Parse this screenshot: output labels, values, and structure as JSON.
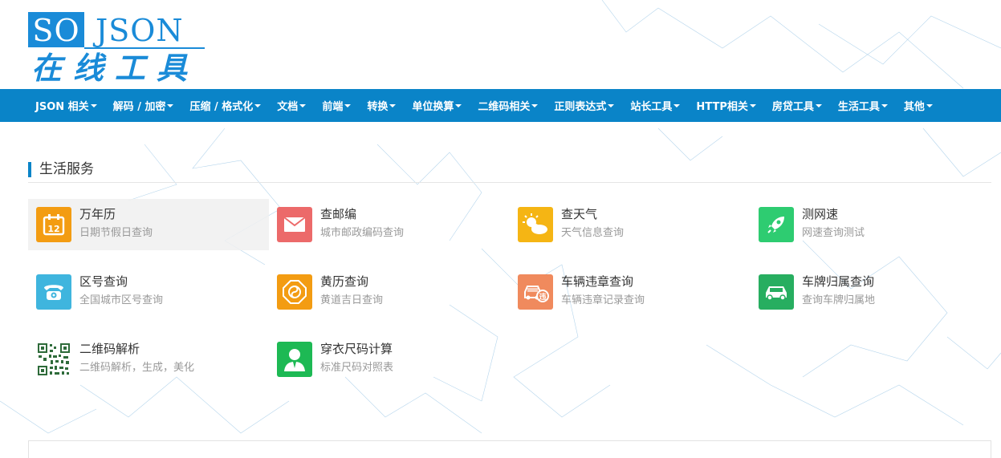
{
  "logo": {
    "so": "SO",
    "json": "JSON",
    "cn": "在线工具"
  },
  "nav": [
    {
      "label": "JSON 相关"
    },
    {
      "label": "解码 / 加密"
    },
    {
      "label": "压缩 / 格式化"
    },
    {
      "label": "文档"
    },
    {
      "label": "前端"
    },
    {
      "label": "转换"
    },
    {
      "label": "单位换算"
    },
    {
      "label": "二维码相关"
    },
    {
      "label": "正则表达式"
    },
    {
      "label": "站长工具"
    },
    {
      "label": "HTTP相关"
    },
    {
      "label": "房贷工具"
    },
    {
      "label": "生活工具"
    },
    {
      "label": "其他"
    }
  ],
  "section": {
    "title": "生活服务"
  },
  "tools": [
    {
      "title": "万年历",
      "desc": "日期节假日查询",
      "icon": "calendar-icon",
      "color": "#f39c12"
    },
    {
      "title": "查邮编",
      "desc": "城市邮政编码查询",
      "icon": "mail-icon",
      "color": "#ec6a6a"
    },
    {
      "title": "查天气",
      "desc": "天气信息查询",
      "icon": "weather-icon",
      "color": "#f5b514"
    },
    {
      "title": "测网速",
      "desc": "网速查询测试",
      "icon": "rocket-icon",
      "color": "#2ecc71"
    },
    {
      "title": "区号查询",
      "desc": "全国城市区号查询",
      "icon": "phone-icon",
      "color": "#3fb5de"
    },
    {
      "title": "黄历查询",
      "desc": "黄道吉日查询",
      "icon": "almanac-icon",
      "color": "#f39c12"
    },
    {
      "title": "车辆违章查询",
      "desc": "车辆违章记录查询",
      "icon": "car-violation-icon",
      "color": "#f08a5d"
    },
    {
      "title": "车牌归属查询",
      "desc": "查询车牌归属地",
      "icon": "car-icon",
      "color": "#27ae60"
    },
    {
      "title": "二维码解析",
      "desc": "二维码解析，生成，美化",
      "icon": "qrcode-icon",
      "color": "#ffffff"
    },
    {
      "title": "穿衣尺码计算",
      "desc": "标准尺码对照表",
      "icon": "person-icon",
      "color": "#1db954"
    }
  ]
}
